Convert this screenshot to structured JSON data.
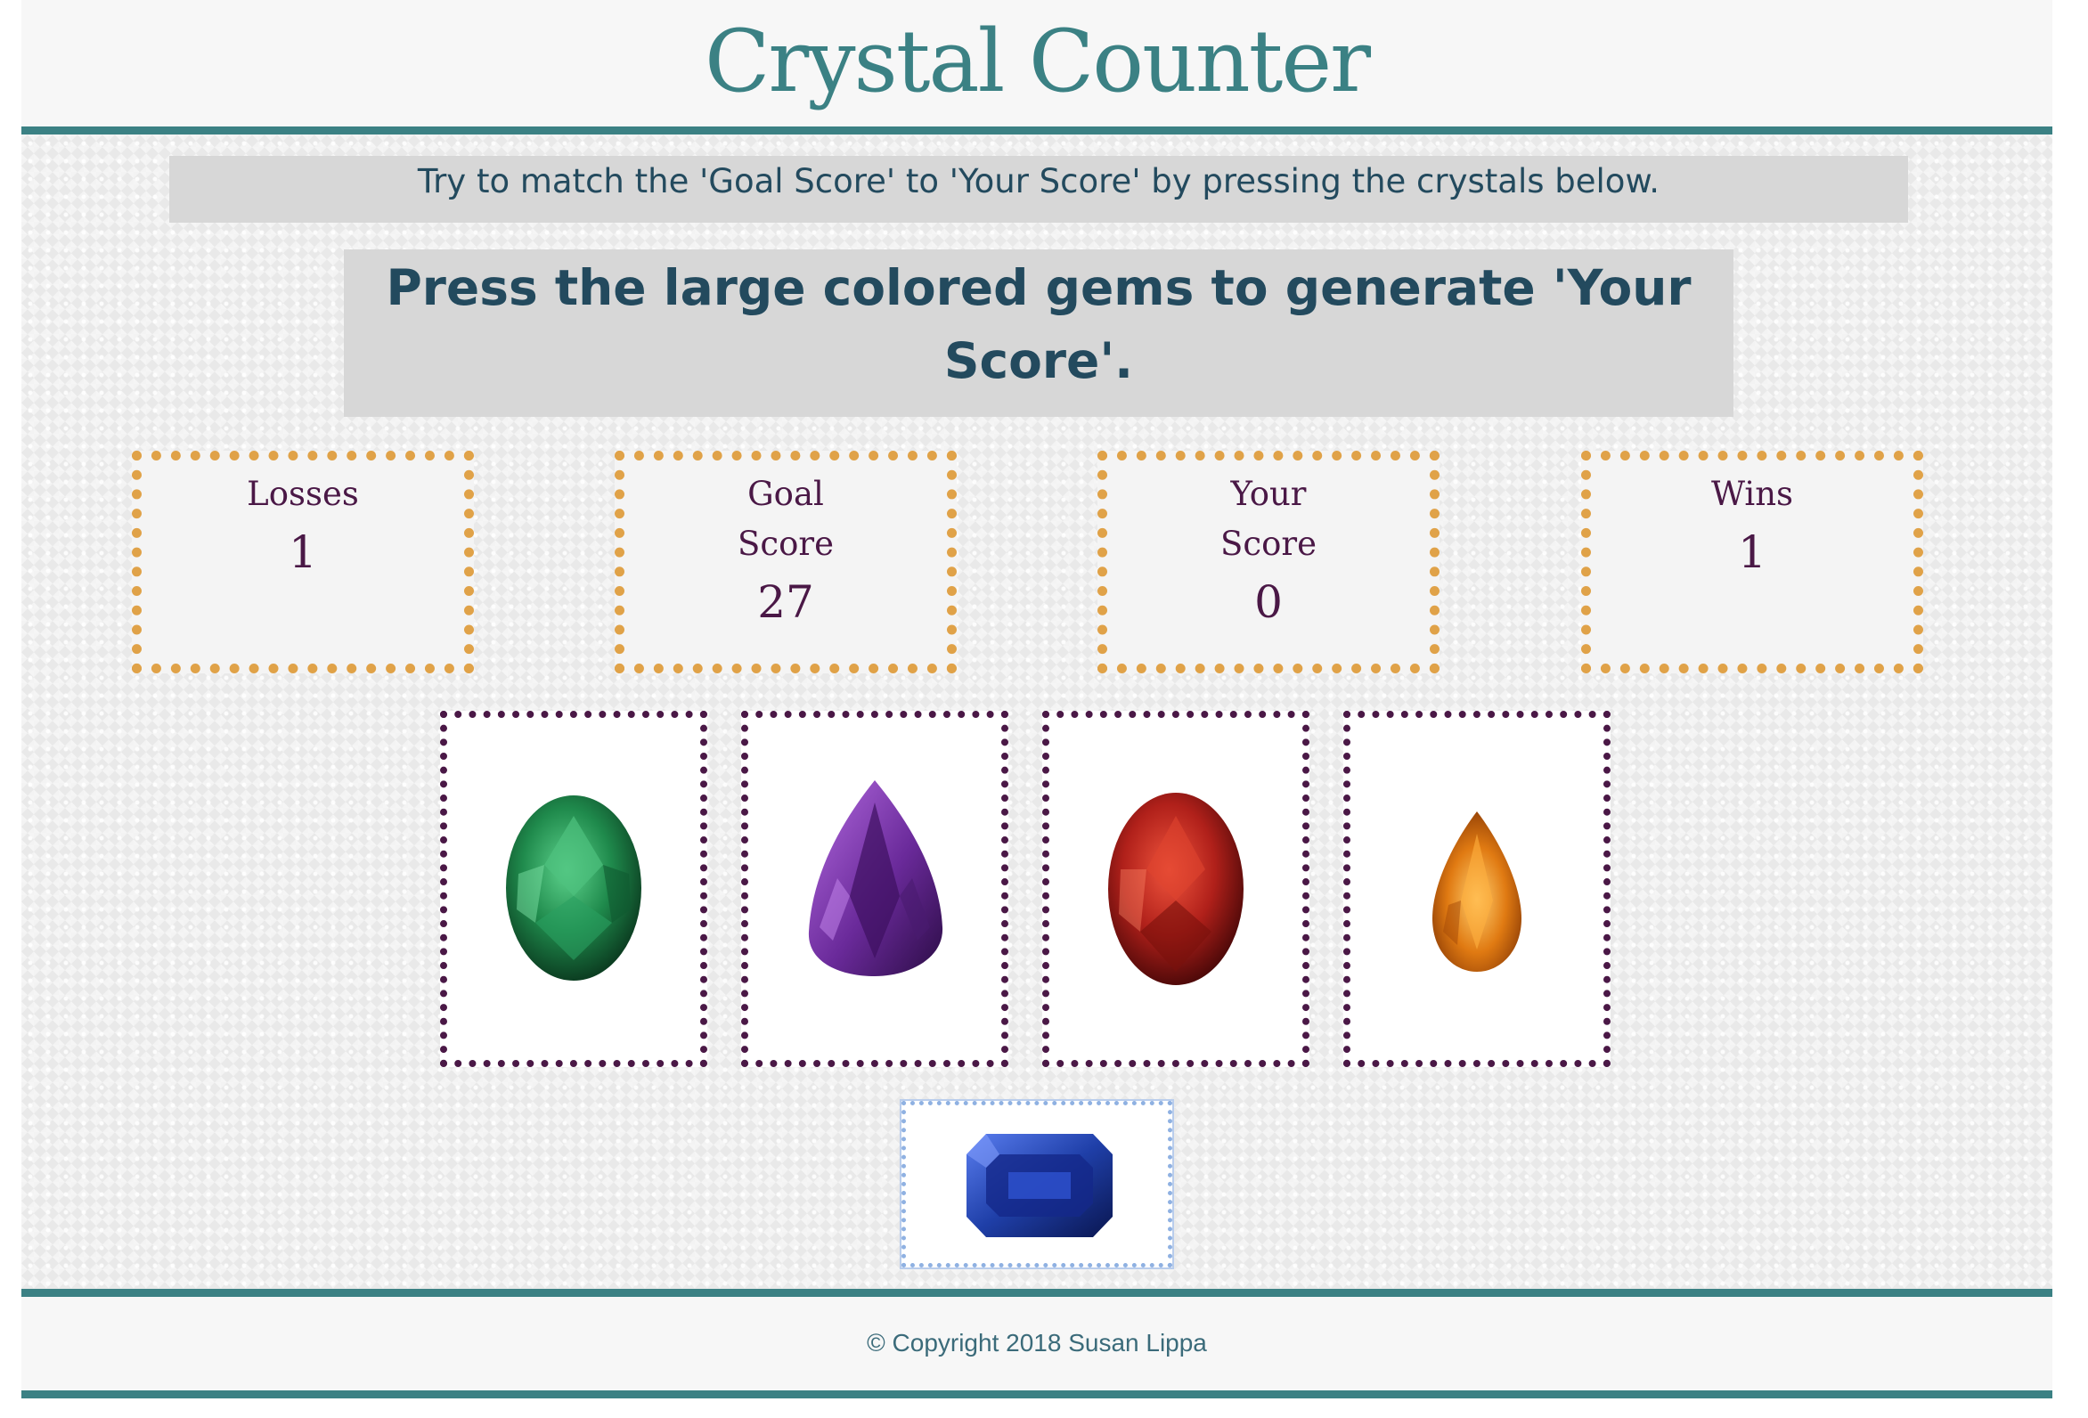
{
  "header": {
    "title": "Crystal Counter"
  },
  "main": {
    "instructions": "Try to match the 'Goal Score' to 'Your Score' by pressing the crystals below.",
    "prompt": "Press the large colored gems to generate 'Your Score'."
  },
  "stats": {
    "losses": {
      "label": "Losses",
      "value": "1"
    },
    "goal": {
      "label": "Goal Score",
      "value": "27"
    },
    "your": {
      "label": "Your Score",
      "value": "0"
    },
    "wins": {
      "label": "Wins",
      "value": "1"
    }
  },
  "gems": [
    {
      "icon": "green-oval-gem",
      "color": "#1f8a4c"
    },
    {
      "icon": "purple-trillion-gem",
      "color": "#6a2a9a"
    },
    {
      "icon": "red-oval-gem",
      "color": "#b0201a"
    },
    {
      "icon": "orange-pear-gem",
      "color": "#e07a12"
    },
    {
      "icon": "blue-emerald-cut-gem",
      "color": "#1f3fa8"
    }
  ],
  "footer": {
    "copyright": "© Copyright 2018 Susan Lippa"
  },
  "colors": {
    "accent": "#3b8184",
    "stat_border": "#e0a248",
    "gem_border": "#4a1846",
    "text_dark": "#234a5e"
  }
}
